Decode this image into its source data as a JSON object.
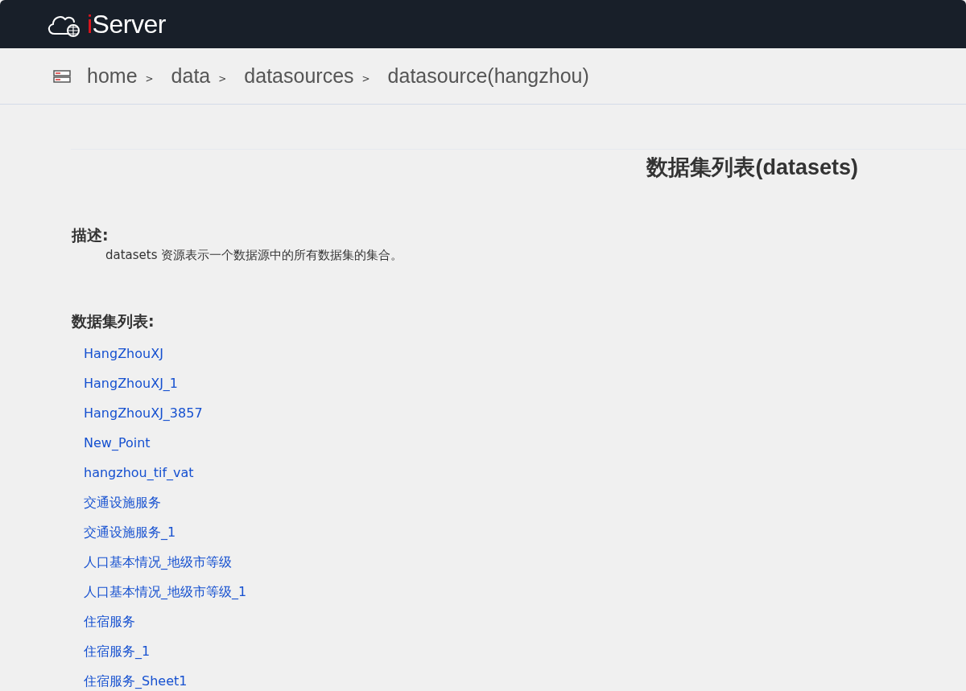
{
  "header": {
    "logo": "iServer"
  },
  "breadcrumb": [
    {
      "label": "home"
    },
    {
      "label": "data"
    },
    {
      "label": "datasources"
    },
    {
      "label": "datasource(hangzhou)"
    }
  ],
  "breadcrumb_separator": ">",
  "title": "数据集列表(datasets)",
  "description": {
    "heading": "描述:",
    "text": "datasets 资源表示一个数据源中的所有数据集的集合。"
  },
  "datasets": {
    "heading": "数据集列表:",
    "items": [
      {
        "label": "HangZhouXJ"
      },
      {
        "label": "HangZhouXJ_1"
      },
      {
        "label": "HangZhouXJ_3857"
      },
      {
        "label": "New_Point"
      },
      {
        "label": "hangzhou_tif_vat"
      },
      {
        "label": "交通设施服务"
      },
      {
        "label": "交通设施服务_1"
      },
      {
        "label": "人口基本情况_地级市等级"
      },
      {
        "label": "人口基本情况_地级市等级_1"
      },
      {
        "label": "住宿服务"
      },
      {
        "label": "住宿服务_1"
      },
      {
        "label": "住宿服务_Sheet1"
      }
    ]
  }
}
